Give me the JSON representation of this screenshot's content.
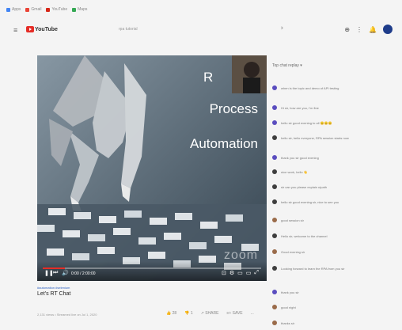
{
  "bookmarks": [
    "Apps",
    "Gmail",
    "YouTube",
    "Maps"
  ],
  "topbar": {
    "menu": "≡",
    "brand": "YouTube",
    "search_value": "rpa tutorial",
    "voice": "⏵"
  },
  "video": {
    "slide_line1": "R",
    "slide_line2": "Process",
    "slide_line3": "Automation",
    "watermark": "zoom",
    "time": "0:00 / 2:00:00",
    "progress": 0.1
  },
  "meta": {
    "hashtags": "#automation #selenium",
    "title": "Let's RT Chat",
    "views": "2,131 views • Streamed live on Jul 1, 2020",
    "actions": [
      "28",
      "1",
      "SHARE",
      "SAVE",
      "..."
    ]
  },
  "chat": {
    "header": "Top chat replay ▾",
    "messages": [
      {
        "avatar": "purple",
        "text": "when is the topic and demo of API testing"
      },
      {
        "avatar": "purple",
        "text": "Hi sir, how are you, I'm fine"
      },
      {
        "avatar": "purple",
        "text": "hello sir good evening to all 😊😊😊"
      },
      {
        "avatar": "dark",
        "text": "hello sir, hello everyone, RPA session starts now"
      },
      {
        "avatar": "purple",
        "text": "thank you sir good evening"
      },
      {
        "avatar": "dark",
        "text": "nice work, hello 👋"
      },
      {
        "avatar": "dark",
        "text": "sir can you please explain uipath"
      },
      {
        "avatar": "dark",
        "text": "hello sir good evening sir, nice to see you"
      },
      {
        "avatar": "brown",
        "text": "good session sir"
      },
      {
        "avatar": "dark",
        "text": "Hello sir, welcome to the channel"
      },
      {
        "avatar": "brown",
        "text": "Good evening sir"
      },
      {
        "avatar": "dark",
        "text": "Looking forward to learn the RPA from you sir"
      },
      {
        "avatar": "purple",
        "text": "thank you sir"
      },
      {
        "avatar": "brown",
        "text": "good night"
      },
      {
        "avatar": "brown",
        "text": "thanks sir"
      }
    ]
  }
}
